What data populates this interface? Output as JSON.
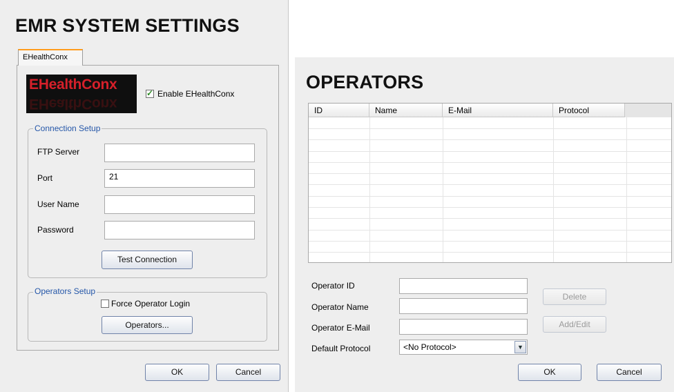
{
  "emr_settings": {
    "title": "EMR SYSTEM SETTINGS",
    "tab_label": "EHealthConx",
    "logo_text": "EHealthConx",
    "enable_label": "Enable EHealthConx",
    "enable_checked": true,
    "connection_setup": {
      "legend": "Connection Setup",
      "ftp_server_label": "FTP Server",
      "ftp_server_value": "",
      "port_label": "Port",
      "port_value": "21",
      "user_name_label": "User Name",
      "user_name_value": "",
      "password_label": "Password",
      "password_value": "",
      "test_button": "Test Connection"
    },
    "operators_setup": {
      "legend": "Operators Setup",
      "force_login_label": "Force Operator Login",
      "force_login_checked": false,
      "operators_button": "Operators..."
    },
    "ok_button": "OK",
    "cancel_button": "Cancel"
  },
  "operators": {
    "title": "OPERATORS",
    "table": {
      "columns": [
        "ID",
        "Name",
        "E-Mail",
        "Protocol"
      ],
      "rows": []
    },
    "operator_id_label": "Operator ID",
    "operator_id_value": "",
    "operator_name_label": "Operator Name",
    "operator_name_value": "",
    "operator_email_label": "Operator E-Mail",
    "operator_email_value": "",
    "default_protocol_label": "Default Protocol",
    "default_protocol_value": "<No Protocol>",
    "delete_button": "Delete",
    "add_edit_button": "Add/Edit",
    "ok_button": "OK",
    "cancel_button": "Cancel"
  },
  "colors": {
    "logo_red": "#d6202a",
    "legend_blue": "#2456a8",
    "tab_accent": "#ff9c1b",
    "check_green": "#2a8a22"
  }
}
